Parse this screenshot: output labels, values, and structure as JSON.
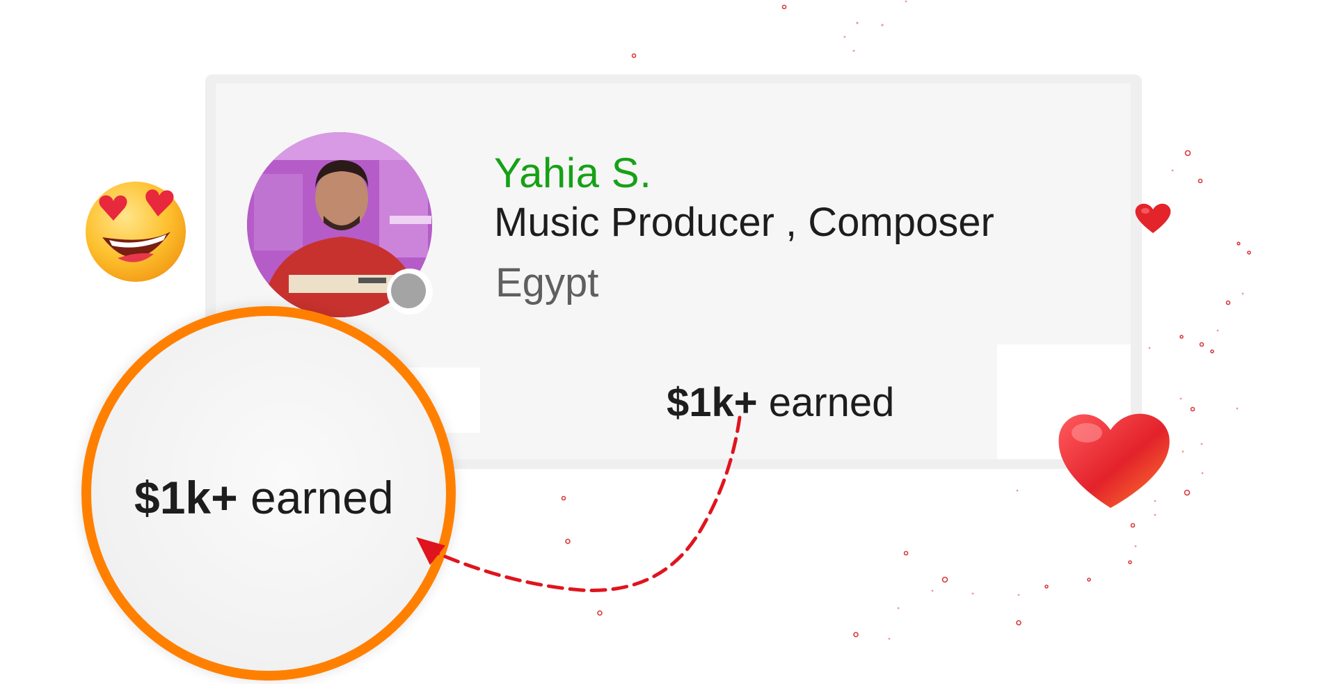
{
  "profile": {
    "name": "Yahia S.",
    "title": "Music Producer , Composer",
    "location": "Egypt",
    "status": "offline"
  },
  "stats": {
    "earned_amount": "$1k+",
    "earned_label": "earned"
  },
  "magnifier": {
    "earned_amount": "$1k+",
    "earned_label": "earned"
  },
  "colors": {
    "name": "#16a116",
    "magnifier_ring": "#ff8000",
    "arrow": "#e0141e",
    "status_offline": "#a4a4a4"
  },
  "icons": {
    "emoji": "heart-eyes-emoji-icon",
    "small_heart": "heart-icon",
    "big_heart": "heart-icon",
    "arrow": "dashed-curved-arrow-icon"
  }
}
